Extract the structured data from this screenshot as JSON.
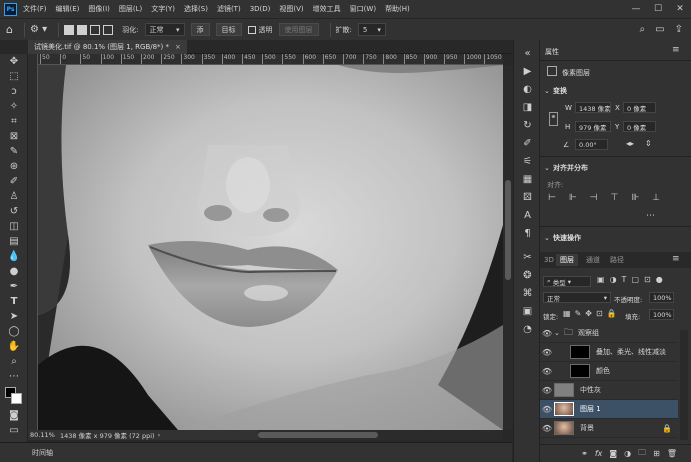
{
  "menubar": {
    "logo": "Ps",
    "items": [
      "文件(F)",
      "编辑(E)",
      "图像(I)",
      "图层(L)",
      "文字(Y)",
      "选择(S)",
      "滤镜(T)",
      "3D(D)",
      "视图(V)",
      "增效工具",
      "窗口(W)",
      "帮助(H)"
    ],
    "window_controls": [
      "—",
      "☐",
      "✕"
    ]
  },
  "options_bar": {
    "feather_label": "羽化:",
    "mode_label": "正常",
    "add_label": "添",
    "target_label": "目标",
    "transparent_label": "透明",
    "use_layer_label": "使用图层",
    "expand_label": "扩散:",
    "expand_value": "5"
  },
  "document": {
    "tab_title": "试镜美化.tif @ 80.1% (图层 1, RGB/8*) *",
    "close": "×"
  },
  "ruler": {
    "ticks": [
      "50",
      "0",
      "50",
      "100",
      "150",
      "200",
      "250",
      "300",
      "350",
      "400",
      "450",
      "500",
      "550",
      "600",
      "650",
      "700",
      "750",
      "800",
      "850",
      "900",
      "950",
      "1000",
      "1050"
    ]
  },
  "status": {
    "zoom": "80.11%",
    "doc_info": "1438 像素 x 979 像素 (72 ppi)"
  },
  "timeline": {
    "label": "时间轴"
  },
  "properties": {
    "title": "属性",
    "layer_kind": "像素图层",
    "transform_title": "变换",
    "w_label": "W",
    "w_value": "1438 像素",
    "x_label": "X",
    "x_value": "0 像素",
    "h_label": "H",
    "h_value": "979 像素",
    "y_label": "Y",
    "y_value": "0 像素",
    "angle_value": "0.00°",
    "align_title": "对齐并分布",
    "align_sub": "对齐:",
    "next_title": "快速操作"
  },
  "layers_panel": {
    "tabs": [
      "3D",
      "图层",
      "通道",
      "路径"
    ],
    "filter_label": "类型",
    "blend_mode": "正常",
    "opacity_label": "不透明度:",
    "opacity_value": "100%",
    "lock_label": "锁定:",
    "fill_label": "填充:",
    "fill_value": "100%",
    "layers": [
      {
        "name": "观察组",
        "type": "group"
      },
      {
        "name": "叠加、柔光、线性减淡",
        "type": "black"
      },
      {
        "name": "颜色",
        "type": "black"
      },
      {
        "name": "中性灰",
        "type": "gray"
      },
      {
        "name": "图层 1",
        "type": "photo",
        "selected": true
      },
      {
        "name": "背景",
        "type": "photo",
        "locked": true
      }
    ],
    "footer_icons": [
      "link-icon",
      "fx-icon",
      "mask-icon",
      "adjustment-icon",
      "folder-icon",
      "new-layer-icon",
      "trash-icon"
    ]
  },
  "colors": {
    "selected_layer": "#3d5166",
    "accent": "#31a8ff"
  }
}
